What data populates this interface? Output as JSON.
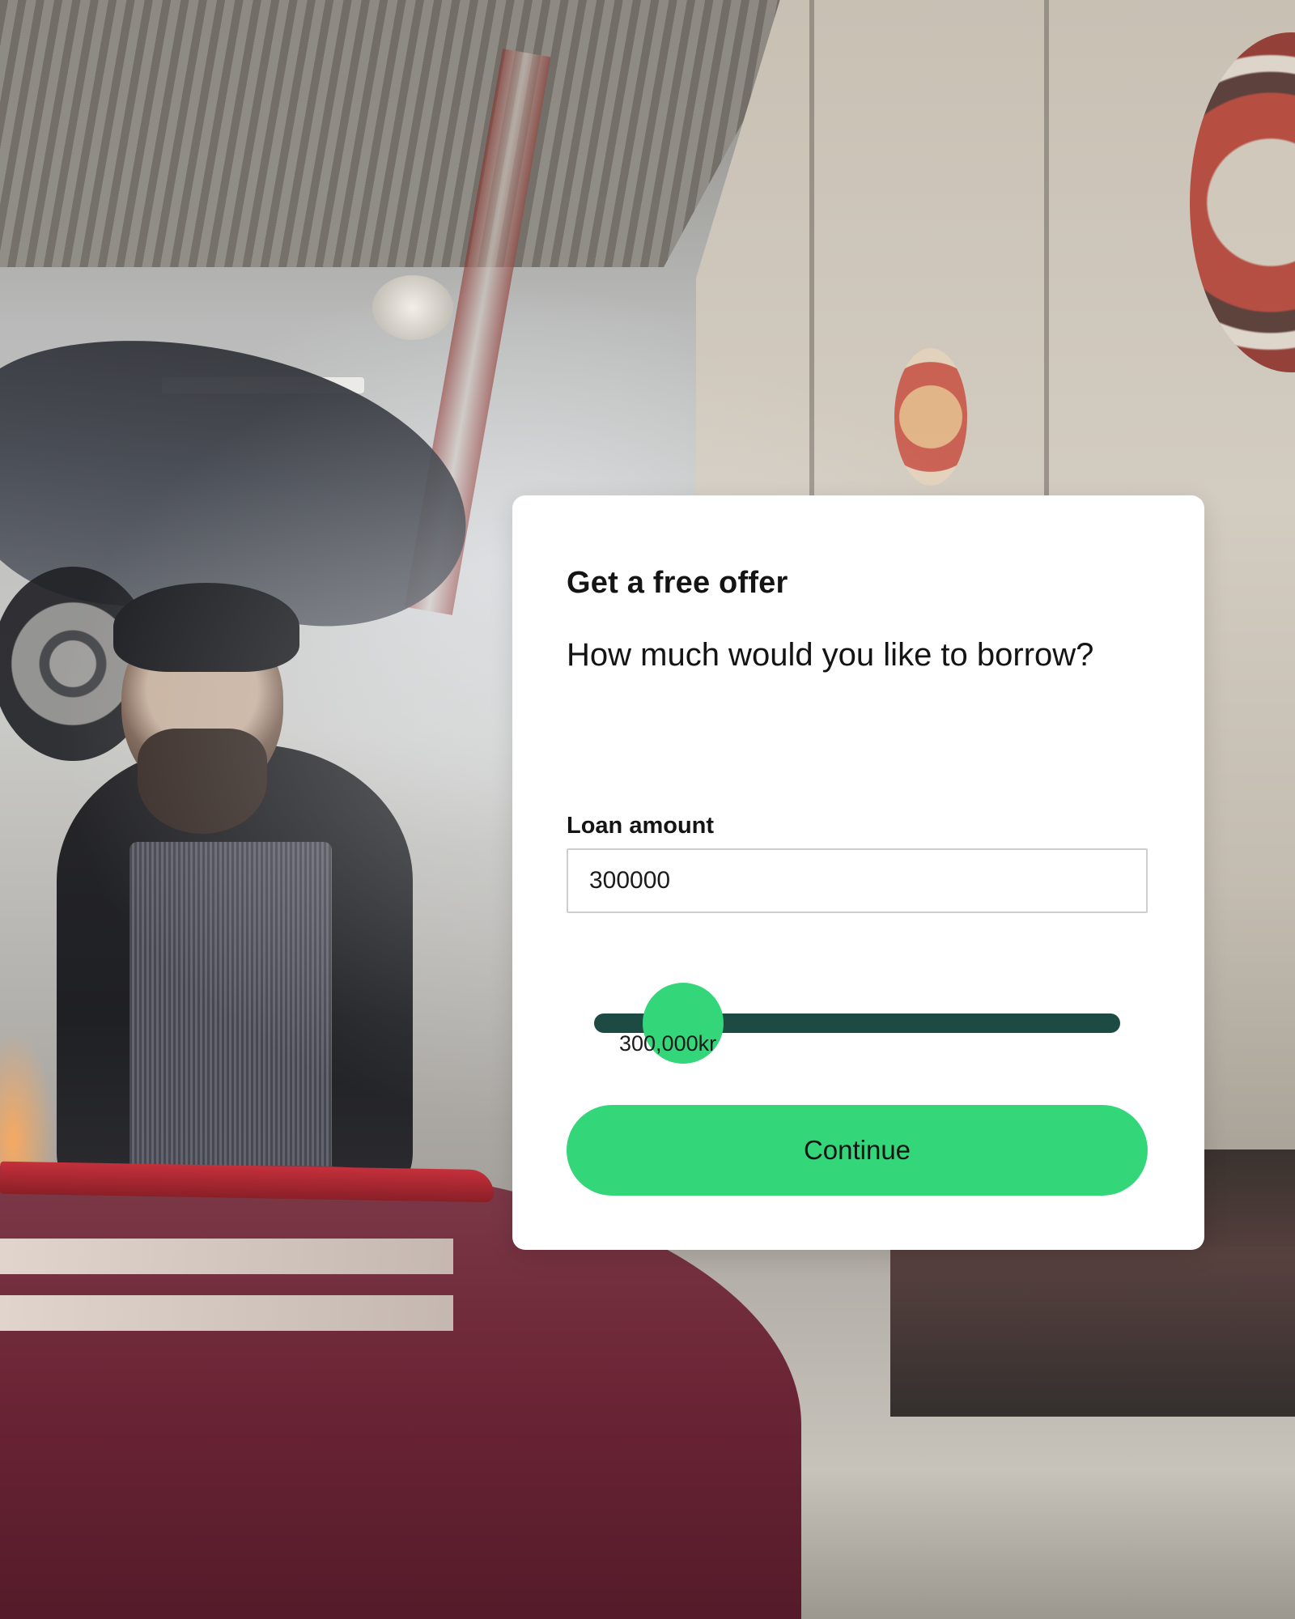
{
  "background": {
    "scene": "garage-mechanic-photo"
  },
  "offer_card": {
    "title": "Get a free offer",
    "question": "How much would you like to borrow?",
    "loan_amount_label": "Loan amount",
    "loan_amount_value": "300000",
    "slider": {
      "value_text": "300,000kr",
      "position_fraction": 0.1
    },
    "continue_label": "Continue"
  },
  "colors": {
    "accent_green": "#34d67a",
    "slider_track": "#1e4a44",
    "card_background": "#ffffff",
    "text_primary": "#141414"
  }
}
